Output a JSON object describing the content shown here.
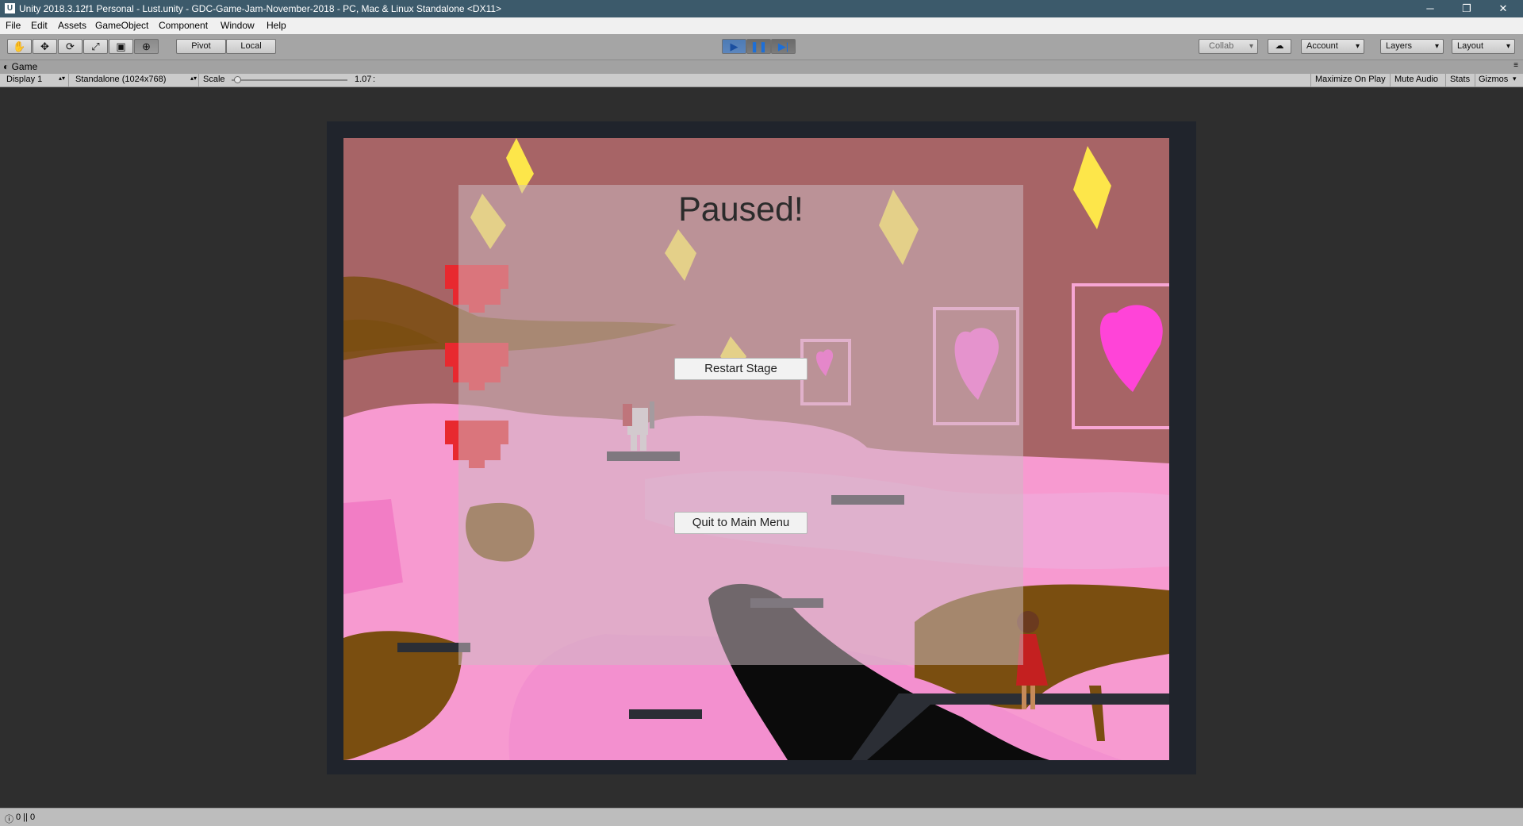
{
  "window": {
    "title": "Unity 2018.3.12f1 Personal - Lust.unity - GDC-Game-Jam-November-2018 - PC, Mac & Linux Standalone <DX11>",
    "minimize": "─",
    "restore": "❐",
    "close": "✕"
  },
  "menu": [
    "File",
    "Edit",
    "Assets",
    "GameObject",
    "Component",
    "Window",
    "Help"
  ],
  "toolbar": {
    "tools": [
      "✋",
      "✥",
      "⟳",
      "⤢",
      "▣",
      "⊕"
    ],
    "pivot": "Pivot",
    "local": "Local",
    "play": "▶",
    "pause": "❚❚",
    "step": "▶|",
    "collab": "Collab",
    "cloud": "☁",
    "account": "Account",
    "layers": "Layers",
    "layout": "Layout"
  },
  "game_tab": {
    "label": "Game",
    "display": "Display 1",
    "resolution": "Standalone (1024x768)",
    "scale_label": "Scale",
    "scale_value": "1.07",
    "scale_fraction": 0.05,
    "maximize": "Maximize On Play",
    "mute": "Mute Audio",
    "stats": "Stats",
    "gizmos": "Gizmos"
  },
  "game": {
    "pause_title": "Paused!",
    "restart_button": "Restart Stage",
    "quit_button": "Quit to Main Menu",
    "hearts": 3,
    "colors": {
      "background": "#a76466",
      "pink": "#f79ad0",
      "brown": "#7a4e10",
      "gem": "#fde64a"
    }
  },
  "status": {
    "text": "0 || 0"
  }
}
